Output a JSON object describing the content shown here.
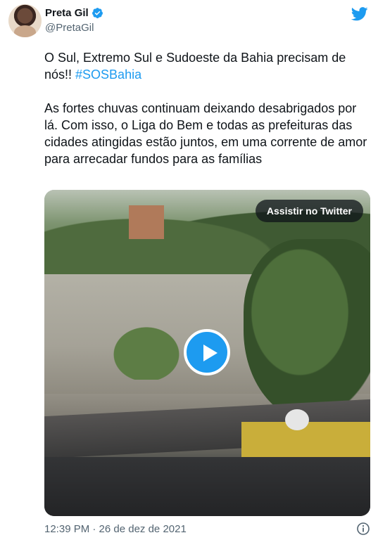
{
  "author": {
    "name": "Preta Gil",
    "handle": "@PretaGil",
    "verified": true,
    "avatar_icon": "user-avatar"
  },
  "brand": {
    "icon": "twitter-bird-icon",
    "color": "#1d9bf0"
  },
  "tweet": {
    "line1": "O Sul, Extremo Sul e Sudoeste da Bahia precisam de nós!! ",
    "hashtag": "#SOSBahia",
    "paragraph2": "As fortes chuvas continuam deixando desabrigados por lá. Com isso, o Liga do Bem e todas as prefeituras das cidades atingidas estão juntos, em uma corrente de amor para arrecadar fundos para as famílias"
  },
  "media": {
    "type": "video",
    "watch_label": "Assistir no Twitter",
    "play_icon": "play-icon"
  },
  "footer": {
    "timestamp": "12:39 PM · 26 de dez de 2021",
    "info_icon": "info-icon"
  },
  "colors": {
    "text": "#0f1419",
    "secondary": "#536471",
    "link": "#1d9bf0"
  }
}
